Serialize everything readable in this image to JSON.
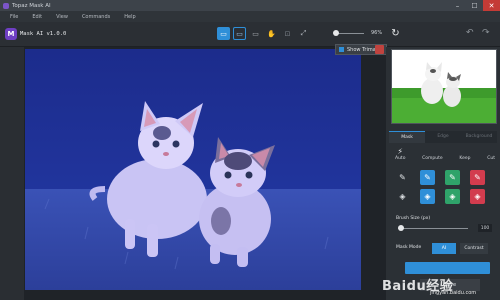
{
  "window": {
    "title": "Topaz Mask AI",
    "minimize": "–",
    "maximize": "☐",
    "close": "✕"
  },
  "menu": {
    "items": [
      "File",
      "Edit",
      "View",
      "Commands",
      "Help"
    ]
  },
  "app": {
    "logo": "M",
    "brand": "Mask AI v1.0.0"
  },
  "toolbar": {
    "buttons": [
      {
        "icon": "single-view-icon",
        "glyph": "▭",
        "active": true
      },
      {
        "icon": "split-view-icon",
        "glyph": "▭",
        "active": false
      },
      {
        "icon": "side-view-icon",
        "glyph": "▭",
        "active": false
      },
      {
        "icon": "pan-hand-icon",
        "glyph": "✋",
        "active": false
      },
      {
        "icon": "zoom-fit-icon",
        "glyph": "⊡",
        "active": false
      },
      {
        "icon": "fit-screen-icon",
        "glyph": "⤢",
        "active": false
      }
    ],
    "zoom": "96%",
    "refresh_glyph": "↻",
    "undo_glyph": "↶",
    "redo_glyph": "↷"
  },
  "overlay": {
    "show_trimap_label": "Show Trimap"
  },
  "panel": {
    "tabs": [
      {
        "label": "Mask",
        "active": true
      },
      {
        "label": "Edge",
        "active": false
      },
      {
        "label": "Background",
        "active": false
      }
    ],
    "tools": {
      "auto": "Auto",
      "compute": "Compute",
      "keep": "Keep",
      "cut": "Cut"
    },
    "grid": [
      {
        "name": "brush-tool-icon",
        "glyph": "✎",
        "color": "plain"
      },
      {
        "name": "keep-brush-icon",
        "glyph": "✎",
        "color": "blue"
      },
      {
        "name": "compute-brush-icon",
        "glyph": "✎",
        "color": "green"
      },
      {
        "name": "cut-brush-icon",
        "glyph": "✎",
        "color": "red"
      },
      {
        "name": "fill-tool-icon",
        "glyph": "◈",
        "color": "plain"
      },
      {
        "name": "keep-fill-icon",
        "glyph": "◈",
        "color": "blue"
      },
      {
        "name": "compute-fill-icon",
        "glyph": "◈",
        "color": "green"
      },
      {
        "name": "cut-fill-icon",
        "glyph": "◈",
        "color": "red"
      }
    ],
    "brush_size_label": "Brush Size (px)",
    "brush_size_value": "100",
    "brush_size_fraction": 0.0,
    "mask_mode_label": "Mask Mode",
    "mask_mode_options": [
      "AI",
      "Contrast"
    ],
    "mask_mode_selected": "AI",
    "save_label": "Save"
  },
  "watermark": {
    "brand": "Baidu经验",
    "site": "jingyan.baidu.com"
  },
  "colors": {
    "accent": "#2f8fd8",
    "keep": "#2f8fd8",
    "compute": "#2fa36a",
    "cut": "#d23c4e",
    "overlay": "#3340c8"
  }
}
